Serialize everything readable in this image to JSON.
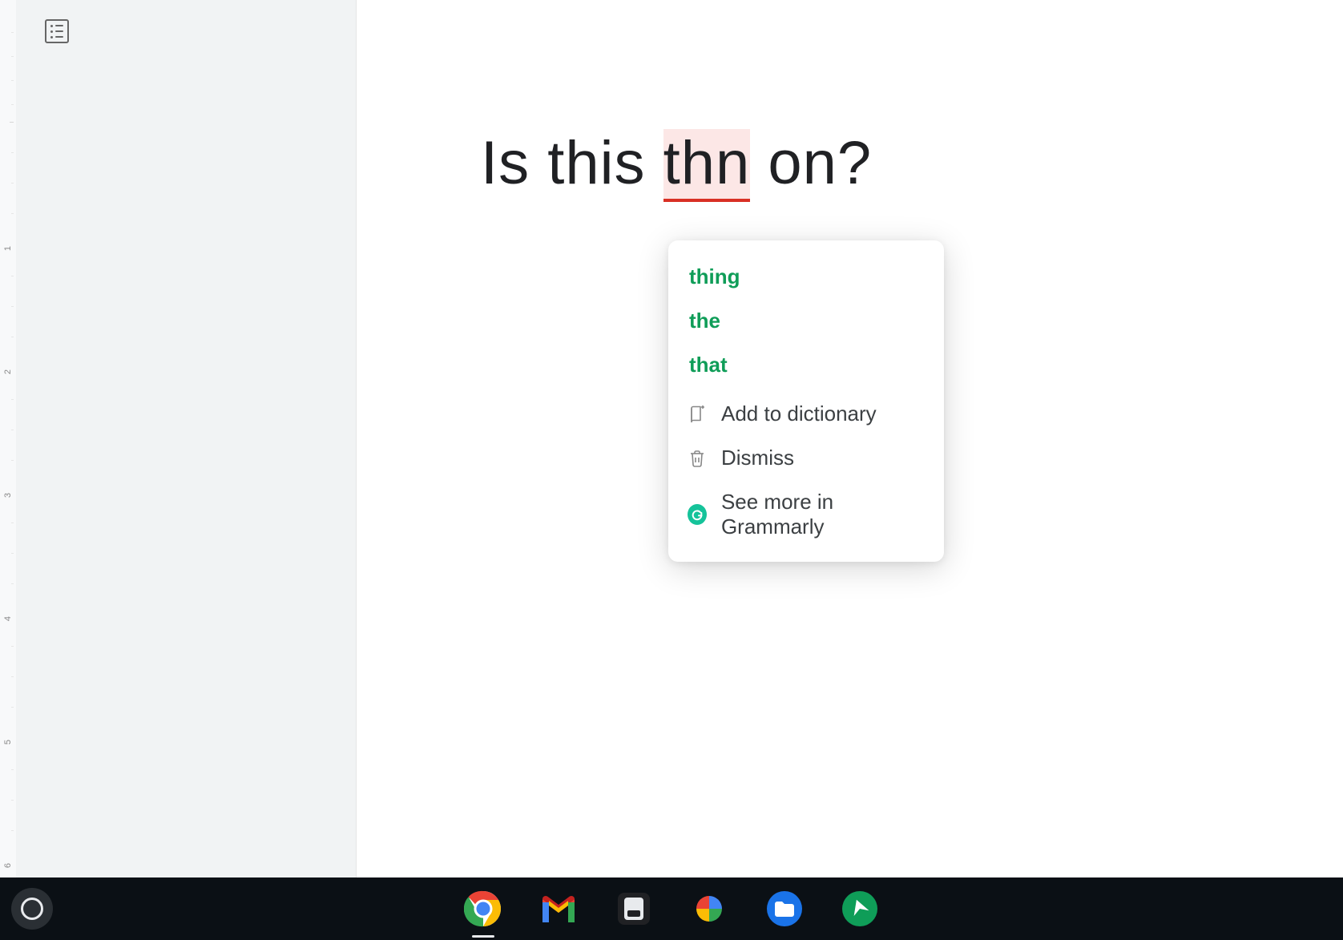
{
  "ruler": {
    "labels": [
      "1",
      "2",
      "3",
      "4",
      "5",
      "6"
    ]
  },
  "document": {
    "text_before": "Is this ",
    "misspelled": "thn",
    "text_after": " on?"
  },
  "popup": {
    "suggestions": [
      "thing",
      "the",
      "that"
    ],
    "add_label": "Add to dictionary",
    "dismiss_label": "Dismiss",
    "more_label": "See more in Grammarly"
  },
  "taskbar": {
    "apps": [
      "chrome",
      "gmail",
      "notes",
      "photos",
      "files",
      "clover"
    ]
  }
}
